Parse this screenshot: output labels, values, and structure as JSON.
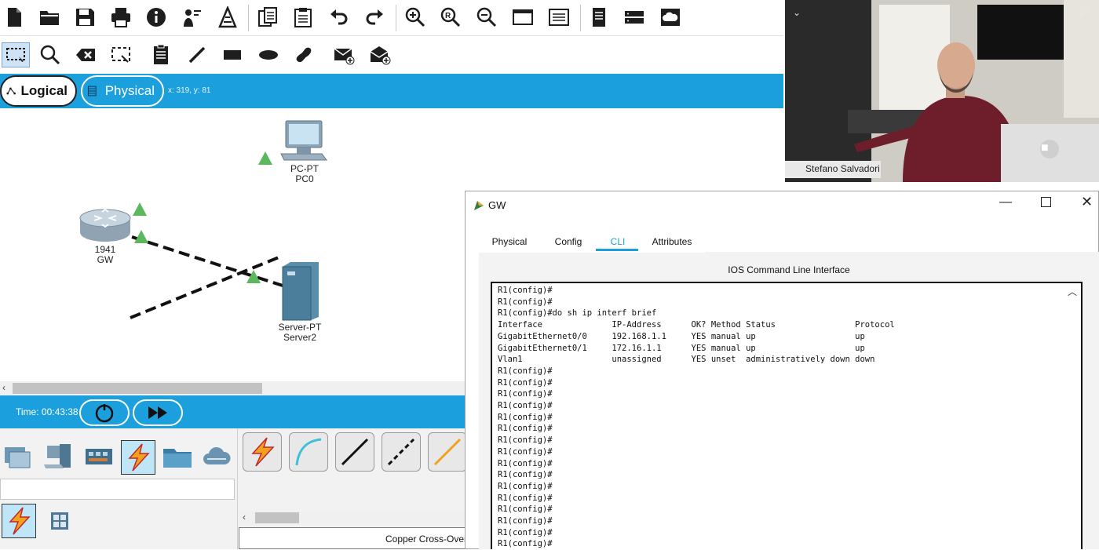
{
  "mode_bar": {
    "logical_label": "Logical",
    "physical_label": "Physical",
    "coords": "x: 319, y: 81"
  },
  "devices": {
    "pc": {
      "model": "PC-PT",
      "name": "PC0"
    },
    "router": {
      "model": "1941",
      "name": "GW"
    },
    "server": {
      "model": "Server-PT",
      "name": "Server2"
    }
  },
  "time_bar": {
    "time": "Time: 00:43:38"
  },
  "connections": {
    "status_text": "Copper Cross-Over"
  },
  "video": {
    "participant_name": "Stefano Salvadori"
  },
  "gw_window": {
    "title": "GW",
    "tabs": [
      {
        "label": "Physical"
      },
      {
        "label": "Config"
      },
      {
        "label": "CLI"
      },
      {
        "label": "Attributes"
      }
    ],
    "active_tab": "CLI",
    "cli_header": "IOS Command Line Interface",
    "cli_lines": [
      "R1(config)#",
      "R1(config)#",
      "R1(config)#do sh ip interf brief",
      "Interface              IP-Address      OK? Method Status                Protocol",
      "GigabitEthernet0/0     192.168.1.1     YES manual up                    up",
      "GigabitEthernet0/1     172.16.1.1      YES manual up                    up",
      "Vlan1                  unassigned      YES unset  administratively down down",
      "R1(config)#",
      "R1(config)#",
      "R1(config)#",
      "R1(config)#",
      "R1(config)#",
      "R1(config)#",
      "R1(config)#",
      "R1(config)#",
      "R1(config)#",
      "R1(config)#",
      "R1(config)#",
      "R1(config)#",
      "R1(config)#",
      "R1(config)#",
      "R1(config)#",
      "R1(config)#"
    ]
  },
  "colors": {
    "accent_blue": "#1b9fdd",
    "link_up_green": "#5cb85c",
    "cli_tab_underline": "#1b9fdd"
  }
}
